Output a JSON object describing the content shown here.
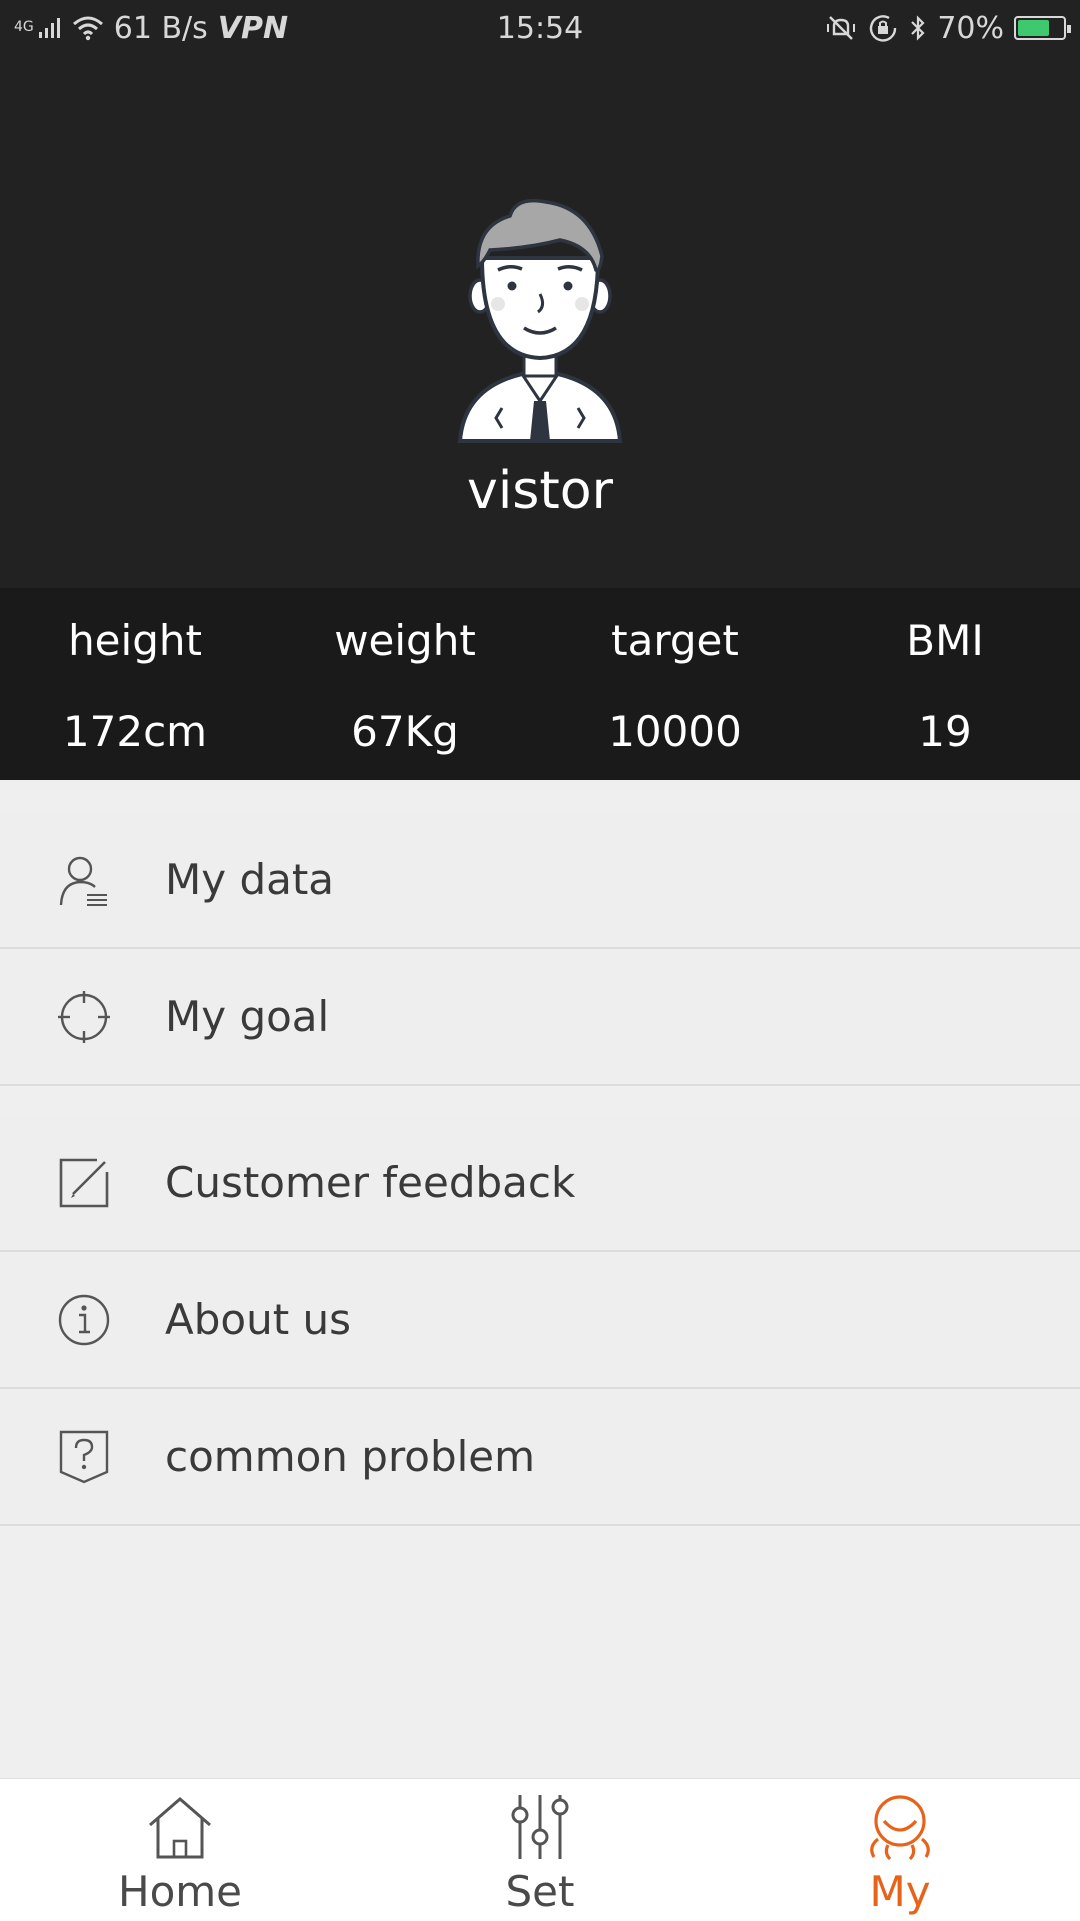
{
  "status_bar": {
    "network_label": "4G",
    "speed": "61 B/s",
    "vpn": "VPN",
    "time": "15:54",
    "battery_text": "70%",
    "battery_level": 0.7,
    "battery_color": "#3ec96f"
  },
  "profile": {
    "username": "vistor"
  },
  "stats": [
    {
      "label": "height",
      "value": "172cm"
    },
    {
      "label": "weight",
      "value": "67Kg"
    },
    {
      "label": "target",
      "value": "10000"
    },
    {
      "label": "BMI",
      "value": "19"
    }
  ],
  "menu": {
    "group1": [
      {
        "label": "My data",
        "icon": "user-list-icon"
      },
      {
        "label": "My goal",
        "icon": "target-icon"
      }
    ],
    "group2": [
      {
        "label": "Customer feedback",
        "icon": "edit-icon"
      },
      {
        "label": "About us",
        "icon": "info-icon"
      },
      {
        "label": "common problem",
        "icon": "question-shield-icon"
      }
    ]
  },
  "bottom_nav": {
    "items": [
      {
        "label": "Home",
        "icon": "home-icon"
      },
      {
        "label": "Set",
        "icon": "sliders-icon"
      },
      {
        "label": "My",
        "icon": "person-icon"
      }
    ],
    "active": "My",
    "active_color": "#e8631a"
  }
}
